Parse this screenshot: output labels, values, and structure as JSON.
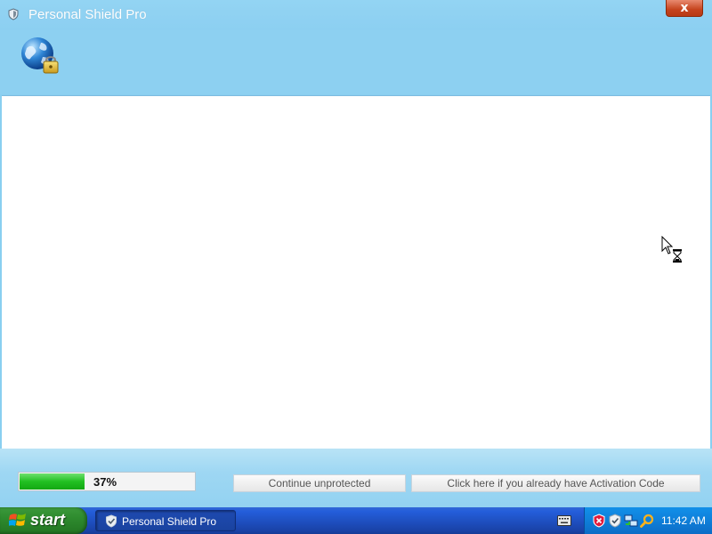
{
  "window": {
    "title": "Personal Shield Pro",
    "close_label": "x"
  },
  "progress": {
    "percent_text": "37%",
    "fraction": 0.37
  },
  "buttons": {
    "continue_label": "Continue unprotected",
    "activate_label": "Click here if you already have Activation Code"
  },
  "taskbar": {
    "start_label": "start",
    "task_label": "Personal Shield Pro",
    "clock": "11:42 AM"
  },
  "colors": {
    "window_bg": "#89cff0",
    "progress_green": "#22c022",
    "taskbar_blue": "#245edb",
    "start_green": "#2e8b2e",
    "close_red": "#c5431d"
  },
  "icons": {
    "title": "shield-icon",
    "header": "globe-lock-icon",
    "tray": [
      "security-alert-icon",
      "shield-tray-icon",
      "network-icon",
      "search-icon"
    ]
  }
}
